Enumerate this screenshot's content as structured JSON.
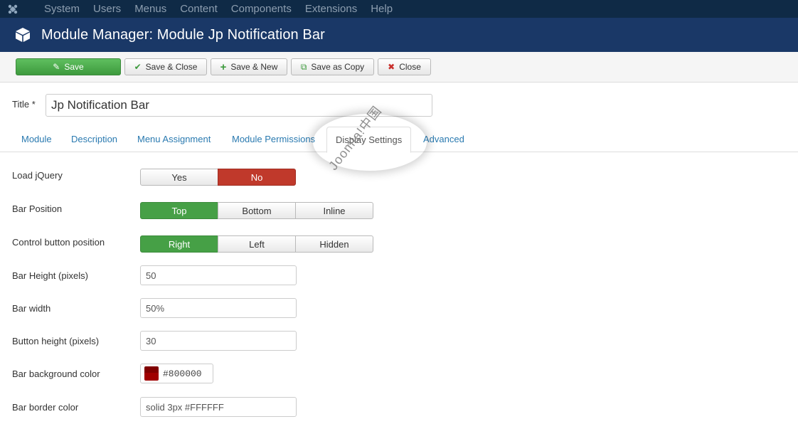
{
  "nav": {
    "items": [
      "System",
      "Users",
      "Menus",
      "Content",
      "Components",
      "Extensions",
      "Help"
    ]
  },
  "header": {
    "title": "Module Manager: Module Jp Notification Bar",
    "icon": "cube-icon"
  },
  "toolbar": {
    "save": "Save",
    "save_close": "Save & Close",
    "save_new": "Save & New",
    "save_copy": "Save as Copy",
    "close": "Close"
  },
  "form_title": {
    "label": "Title *",
    "value": "Jp Notification Bar"
  },
  "tabs": [
    "Module",
    "Description",
    "Menu Assignment",
    "Module Permissions",
    "Display Settings",
    "Advanced"
  ],
  "active_tab": "Display Settings",
  "watermark": "Joomla!中国",
  "fields": {
    "load_jquery": {
      "label": "Load jQuery",
      "options": [
        "Yes",
        "No"
      ],
      "selected": "No"
    },
    "bar_position": {
      "label": "Bar Position",
      "options": [
        "Top",
        "Bottom",
        "Inline"
      ],
      "selected": "Top"
    },
    "control_button_position": {
      "label": "Control button position",
      "options": [
        "Right",
        "Left",
        "Hidden"
      ],
      "selected": "Right"
    },
    "bar_height": {
      "label": "Bar Height (pixels)",
      "value": "50"
    },
    "bar_width": {
      "label": "Bar width",
      "value": "50%"
    },
    "button_height": {
      "label": "Button height (pixels)",
      "value": "30"
    },
    "bar_background_color": {
      "label": "Bar background color",
      "value": "#800000"
    },
    "bar_border_color": {
      "label": "Bar border color",
      "value": "solid 3px #FFFFFF"
    }
  },
  "colors": {
    "nav_bg": "#0f2a46",
    "header_bg": "#1a3867",
    "green": "#46a046",
    "red": "#c0392b",
    "link": "#2a7ab0",
    "swatch": "#800000"
  }
}
